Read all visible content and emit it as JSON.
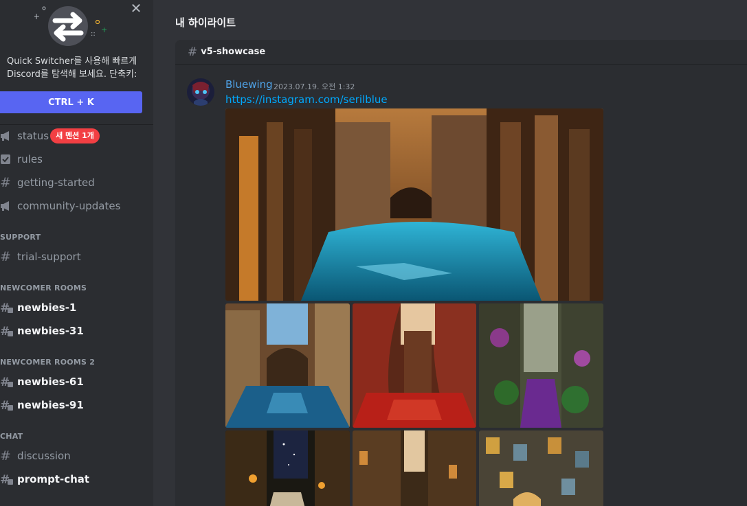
{
  "switcher": {
    "text": "Quick Switcher를 사용해 빠르게 Discord를 탐색해 보세요. 단축키:",
    "shortcut": "CTRL + K"
  },
  "sidebar": {
    "channels_top": [
      {
        "label": "status",
        "icon": "megaphone-icon",
        "badge": "새 멘션 1개"
      },
      {
        "label": "rules",
        "icon": "checkbox-icon"
      },
      {
        "label": "getting-started",
        "icon": "hash-icon"
      },
      {
        "label": "community-updates",
        "icon": "megaphone-icon"
      }
    ],
    "categories": [
      {
        "name": "SUPPORT",
        "channels": [
          {
            "label": "trial-support",
            "icon": "hash-icon"
          }
        ]
      },
      {
        "name": "NEWCOMER ROOMS",
        "channels": [
          {
            "label": "newbies-1",
            "icon": "thread-hash-icon"
          },
          {
            "label": "newbies-31",
            "icon": "thread-hash-icon"
          }
        ]
      },
      {
        "name": "NEWCOMER ROOMS 2",
        "channels": [
          {
            "label": "newbies-61",
            "icon": "thread-hash-icon"
          },
          {
            "label": "newbies-91",
            "icon": "thread-hash-icon"
          }
        ]
      },
      {
        "name": "CHAT",
        "channels": [
          {
            "label": "discussion",
            "icon": "hash-icon"
          },
          {
            "label": "prompt-chat",
            "icon": "thread-hash-icon"
          }
        ]
      }
    ]
  },
  "main": {
    "title": "내 하이라이트",
    "channel": "v5-showcase",
    "message": {
      "author": "Bluewing",
      "timestamp": "2023.07.19. 오전 1:32",
      "link": "https://instagram.com/serilblue"
    }
  },
  "colors": {
    "accent": "#5865f2",
    "mention": "#f23f43",
    "link": "#00a8fc",
    "author": "#4fa3e8"
  }
}
